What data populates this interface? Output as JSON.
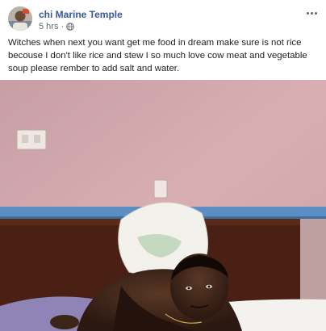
{
  "post": {
    "author_name": "chi Marine Temple",
    "timestamp": "5 hrs",
    "separator": "·",
    "audience_icon": "globe-icon",
    "more_icon": "ellipsis-icon",
    "text": "Witches when next you want get me food in dream make sure is not rice becouse I don't like rice and stew I so much love cow meat and vegetable soup please rember to add salt and water.",
    "photo": {
      "wall_color": "#d3a9ae",
      "trim_color": "#5b8fc4",
      "headboard_color": "#4a1f14",
      "sheet_color": "#8e84b6"
    }
  }
}
